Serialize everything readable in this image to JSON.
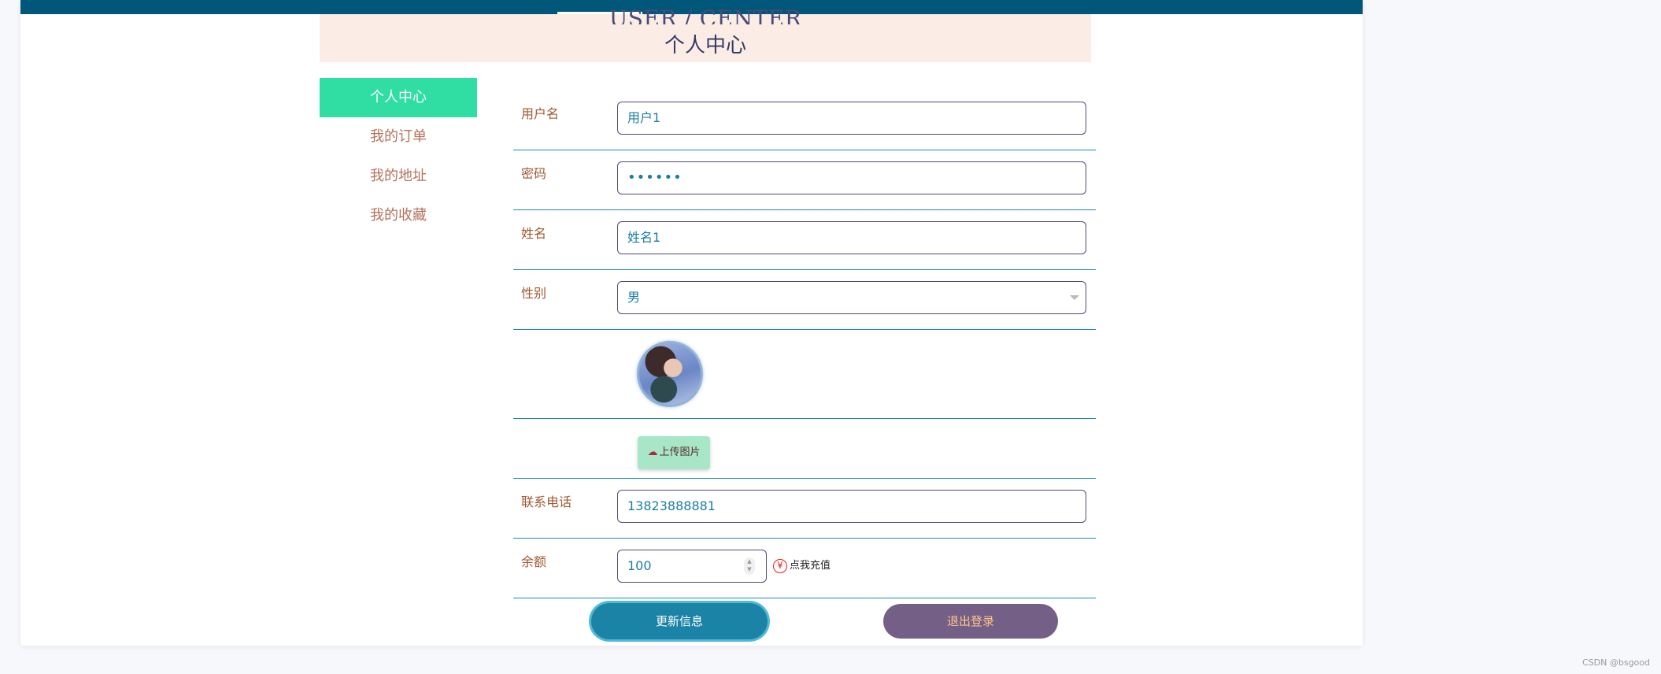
{
  "header": {
    "title_en": "USER / CENTER",
    "title_cn": "个人中心"
  },
  "sidebar": {
    "items": [
      {
        "label": "个人中心",
        "active": true
      },
      {
        "label": "我的订单",
        "active": false
      },
      {
        "label": "我的地址",
        "active": false
      },
      {
        "label": "我的收藏",
        "active": false
      }
    ]
  },
  "form": {
    "username": {
      "label": "用户名",
      "value": "用户1"
    },
    "password": {
      "label": "密码",
      "value": "••••••"
    },
    "name": {
      "label": "姓名",
      "value": "姓名1"
    },
    "gender": {
      "label": "性别",
      "value": "男"
    },
    "upload": {
      "label": "上传图片",
      "icon": "cloud-upload-icon"
    },
    "phone": {
      "label": "联系电话",
      "value": "13823888881"
    },
    "balance": {
      "label": "余额",
      "value": "100",
      "recharge_label": "点我充值",
      "recharge_icon": "yen-icon"
    }
  },
  "actions": {
    "update_label": "更新信息",
    "logout_label": "退出登录"
  },
  "footer": {
    "watermark": "CSDN @bsgood"
  },
  "colors": {
    "topbar": "#00577a",
    "active_menu": "#30dea3",
    "update_button": "#1b84a6",
    "logout_button": "#745f86"
  }
}
